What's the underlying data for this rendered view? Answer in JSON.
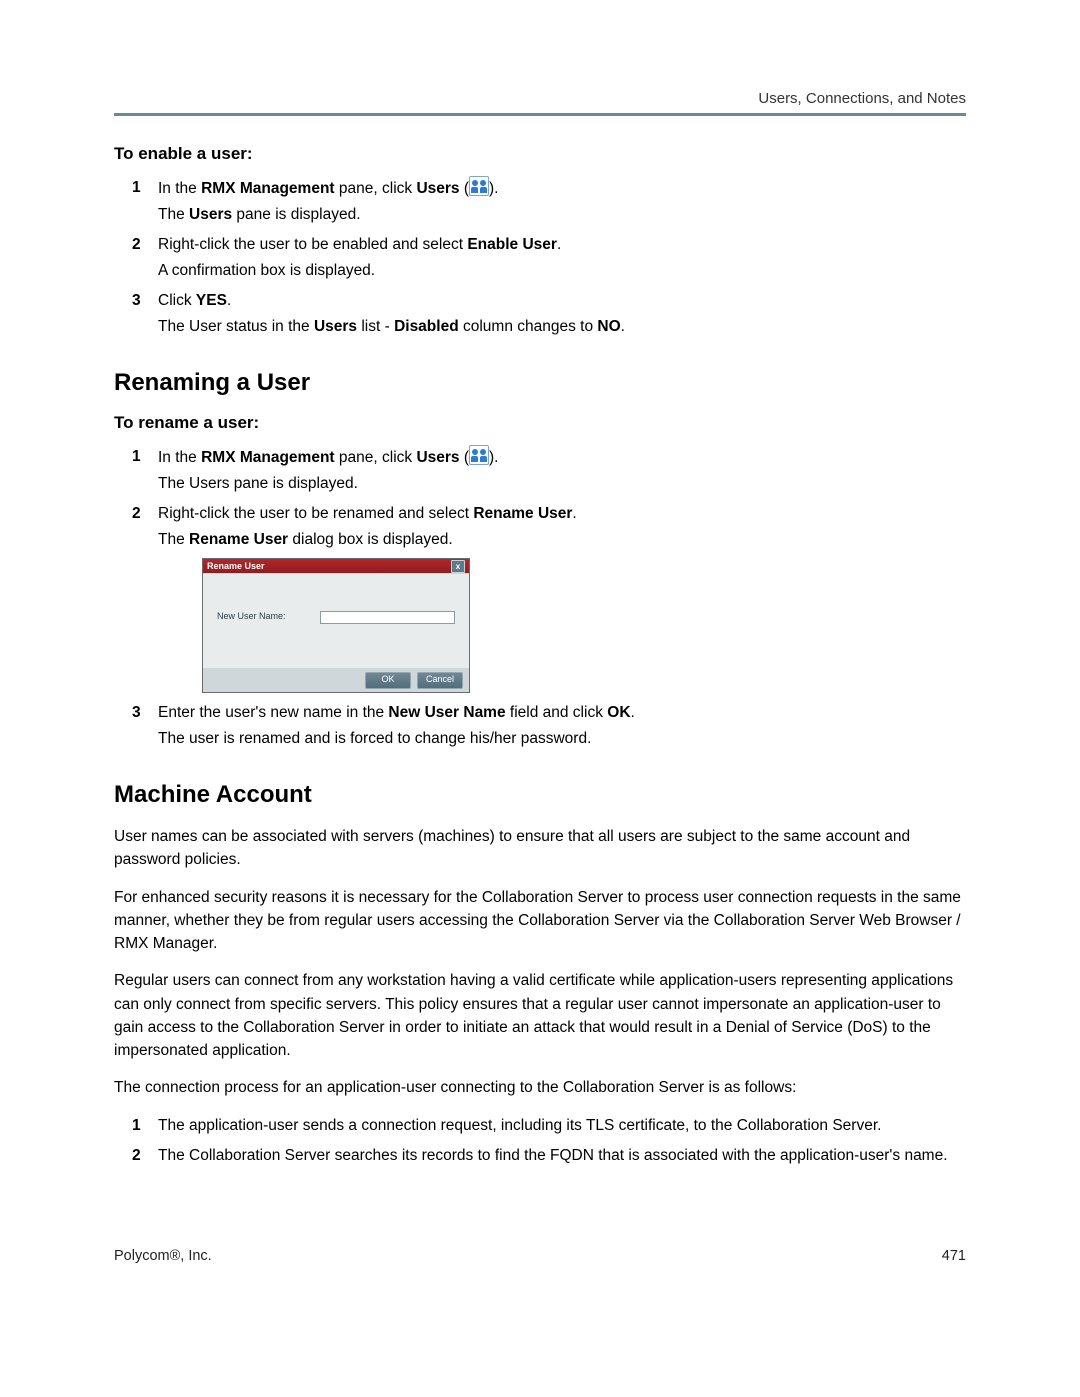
{
  "header": {
    "running_head": "Users, Connections, and Notes"
  },
  "enable": {
    "title": "To enable a user:",
    "steps": {
      "s1_num": "1",
      "s1_pre": "In the ",
      "s1_b1": "RMX Management",
      "s1_mid": " pane, click ",
      "s1_b2": "Users",
      "s1_post": " (",
      "s1_close": ").",
      "s1_sub_pre": "The ",
      "s1_sub_b": "Users",
      "s1_sub_post": " pane is displayed.",
      "s2_num": "2",
      "s2_pre": "Right-click the user to be enabled and select ",
      "s2_b": "Enable User",
      "s2_post": ".",
      "s2_sub": "A confirmation box is displayed.",
      "s3_num": "3",
      "s3_pre": "Click ",
      "s3_b": "YES",
      "s3_post": ".",
      "s3_sub_pre": "The User status in the ",
      "s3_sub_b1": "Users",
      "s3_sub_mid": " list - ",
      "s3_sub_b2": "Disabled",
      "s3_sub_mid2": " column changes to ",
      "s3_sub_b3": "NO",
      "s3_sub_end": "."
    }
  },
  "rename": {
    "heading": "Renaming a User",
    "title": "To rename a user:",
    "steps": {
      "s1_num": "1",
      "s1_pre": "In the ",
      "s1_b1": "RMX Management",
      "s1_mid": " pane, click ",
      "s1_b2": "Users",
      "s1_post": " (",
      "s1_close": ").",
      "s1_sub": "The Users pane is displayed.",
      "s2_num": "2",
      "s2_pre": "Right-click the user to be renamed and select ",
      "s2_b": "Rename User",
      "s2_post": ".",
      "s2_sub_pre": "The ",
      "s2_sub_b": "Rename User",
      "s2_sub_post": " dialog box is displayed.",
      "s3_num": "3",
      "s3_pre": "Enter the user's new name in the ",
      "s3_b1": "New User Name",
      "s3_mid": " field and click ",
      "s3_b2": "OK",
      "s3_post": ".",
      "s3_sub": "The user is renamed and is forced to change his/her password."
    },
    "dialog": {
      "title": "Rename User",
      "close": "x",
      "label": "New User Name:",
      "ok": "OK",
      "cancel": "Cancel"
    }
  },
  "machine": {
    "heading": "Machine Account",
    "p1": "User names can be associated with servers (machines) to ensure that all users are subject to the same account and password policies.",
    "p2": "For enhanced security reasons it is necessary for the Collaboration Server to process user connection requests in the same manner, whether they be from regular users accessing the Collaboration Server via the Collaboration Server Web Browser / RMX Manager.",
    "p3": "Regular users can connect from any workstation having a valid certificate while application-users representing applications can only connect from specific servers. This policy ensures that a regular user cannot impersonate an application-user to gain access to the Collaboration Server in order to initiate an attack that would result in a Denial of Service (DoS) to the impersonated application.",
    "p4": "The connection process for an application-user connecting to the Collaboration Server is as follows:",
    "steps": {
      "s1_num": "1",
      "s1": "The application-user sends a connection request, including its TLS certificate, to the Collaboration Server.",
      "s2_num": "2",
      "s2": "The Collaboration Server searches its records to find the FQDN that is associated with the application-user's name."
    }
  },
  "footer": {
    "left": "Polycom®, Inc.",
    "right": "471"
  }
}
